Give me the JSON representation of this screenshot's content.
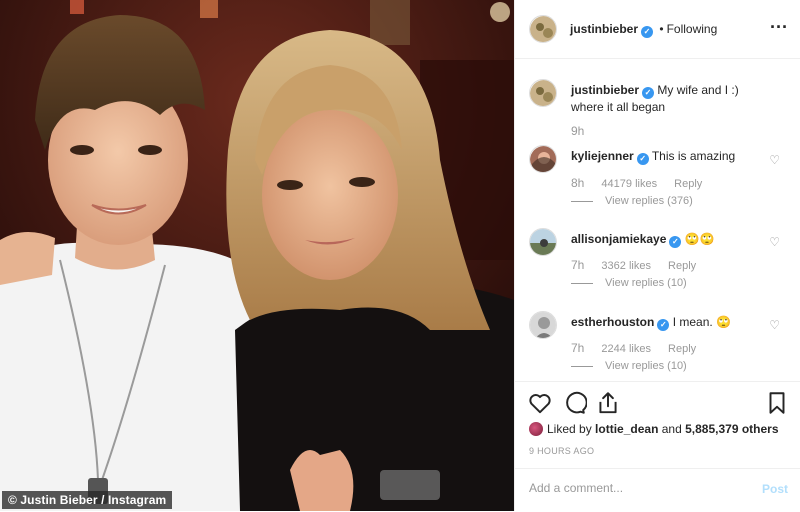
{
  "photo": {
    "credit": "© Justin Bieber / Instagram"
  },
  "post": {
    "username": "justinbieber",
    "follow_state": "Following",
    "more_icon": "more-horizontal-icon",
    "caption": {
      "username": "justinbieber",
      "text": "My wife and I :) where it all began",
      "time": "9h"
    },
    "comments": [
      {
        "username": "kyliejenner",
        "verified": true,
        "text": "This is amazing",
        "time": "8h",
        "likes": "44179 likes",
        "reply": "Reply",
        "view_replies": "View replies (376)"
      },
      {
        "username": "allisonjamiekaye",
        "verified": true,
        "text": "🙄🙄",
        "time": "7h",
        "likes": "3362 likes",
        "reply": "Reply",
        "view_replies": "View replies (10)"
      },
      {
        "username": "estherhouston",
        "verified": true,
        "text": "I mean. 🙄",
        "time": "7h",
        "likes": "2244 likes",
        "reply": "Reply",
        "view_replies": "View replies (10)"
      }
    ],
    "actions": {
      "like_icon": "heart-icon",
      "comment_icon": "comment-icon",
      "share_icon": "share-icon",
      "save_icon": "bookmark-icon"
    },
    "liked_by_prefix": "Liked by",
    "liked_by_user": "lottie_dean",
    "liked_by_suffix": "and",
    "liked_by_count": "5,885,379 others",
    "time_ago": "9 HOURS AGO",
    "comment_placeholder": "Add a comment...",
    "post_label": "Post"
  },
  "colors": {
    "verified": "#3897f0",
    "meta_text": "#999999",
    "post_button": "#b2dffc"
  }
}
